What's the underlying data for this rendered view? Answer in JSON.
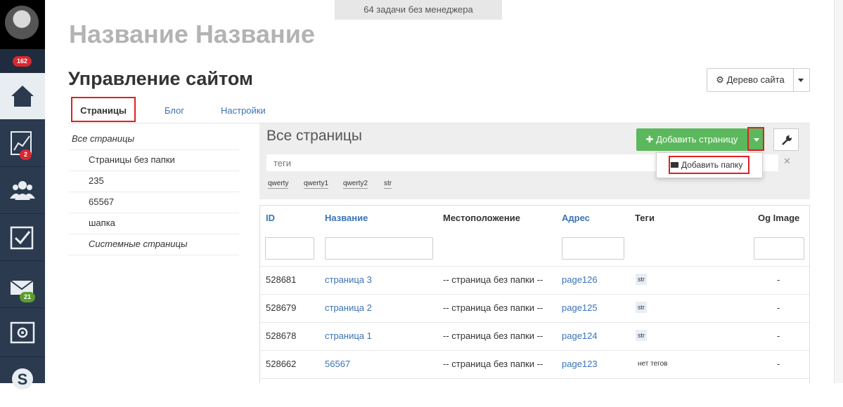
{
  "top_notice": "64 задачи без менеджера",
  "org_title": "Название Название",
  "page_heading": "Управление сайтом",
  "site_tree_button": "Дерево сайта",
  "sidebar": {
    "notifications_badge": "162",
    "analytics_badge": "2",
    "mail_badge": "21",
    "items": [
      "home-icon",
      "analytics-icon",
      "users-icon",
      "tasks-icon",
      "mail-icon",
      "safe-icon",
      "skype-icon"
    ]
  },
  "tabs": [
    "Страницы",
    "Блог",
    "Настройки"
  ],
  "folders": {
    "all": "Все страницы",
    "items": [
      "Страницы без папки",
      "235",
      "65567",
      "шапка"
    ],
    "system": "Системные страницы"
  },
  "panel": {
    "title": "Все страницы",
    "add_page": "Добавить страницу",
    "tags_placeholder": "теги",
    "tag_chips": [
      "qwerty",
      "qwerty1",
      "qwerty2",
      "str"
    ],
    "dropdown_item": "Добавить папку"
  },
  "table": {
    "headers": [
      "ID",
      "Название",
      "Местоположение",
      "Адрес",
      "Теги",
      "Og Image"
    ],
    "rows": [
      {
        "id": "528681",
        "name": "страница 3",
        "location": "-- страница без папки --",
        "address": "page126",
        "tags": "str",
        "og": "-"
      },
      {
        "id": "528679",
        "name": "страница 2",
        "location": "-- страница без папки --",
        "address": "page125",
        "tags": "str",
        "og": "-"
      },
      {
        "id": "528678",
        "name": "страница 1",
        "location": "-- страница без папки --",
        "address": "page124",
        "tags": "str",
        "og": "-"
      },
      {
        "id": "528662",
        "name": "56567",
        "location": "-- страница без папки --",
        "address": "page123",
        "tags": "нет тегов",
        "og": "-"
      }
    ]
  },
  "colors": {
    "sidebar": "#2b3a4f",
    "accent_link": "#3a73b7",
    "green_button": "#5cb85c",
    "highlight": "#e02020"
  }
}
